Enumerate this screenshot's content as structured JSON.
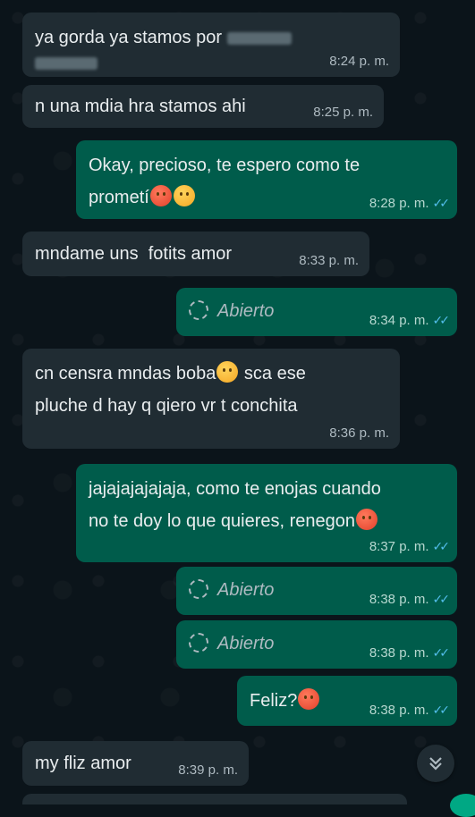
{
  "messages": [
    {
      "dir": "in",
      "text": "ya gorda ya stamos por",
      "time": "8:24 p. m."
    },
    {
      "dir": "in",
      "text": "n una mdia hra stamos ahi",
      "time": "8:25 p. m."
    },
    {
      "dir": "out",
      "text": "Okay, precioso, te espero como te prometí",
      "time": "8:28 p. m."
    },
    {
      "dir": "in",
      "text": "mndame uns  fotits amor",
      "time": "8:33 p. m."
    },
    {
      "dir": "out",
      "text": "Abierto",
      "time": "8:34 p. m.",
      "view_once": true
    },
    {
      "dir": "in",
      "text_line1": "cn censra mndas boba",
      "text_line1b": "sca ese",
      "text_line2": "pluche d hay q qiero vr t conchita",
      "time": "8:36 p. m."
    },
    {
      "dir": "out",
      "text_line1": "jajajajajajaja, como te enojas cuando",
      "text_line2": "no te doy lo que quieres, renegon",
      "time": "8:37 p. m."
    },
    {
      "dir": "out",
      "text": "Abierto",
      "time": "8:38 p. m.",
      "view_once": true
    },
    {
      "dir": "out",
      "text": "Abierto",
      "time": "8:38 p. m.",
      "view_once": true
    },
    {
      "dir": "out",
      "text": "Feliz?",
      "time": "8:38 p. m."
    },
    {
      "dir": "in",
      "text": "my fliz amor",
      "time": "8:39 p. m."
    }
  ],
  "read_ticks": "✓✓",
  "icons": {
    "scroll_down": "double-chevron-down-icon",
    "view_once": "view-once-icon"
  },
  "colors": {
    "incoming": "#202c33",
    "outgoing": "#005c4b",
    "background": "#0b141a",
    "ticks": "#53bdeb"
  }
}
